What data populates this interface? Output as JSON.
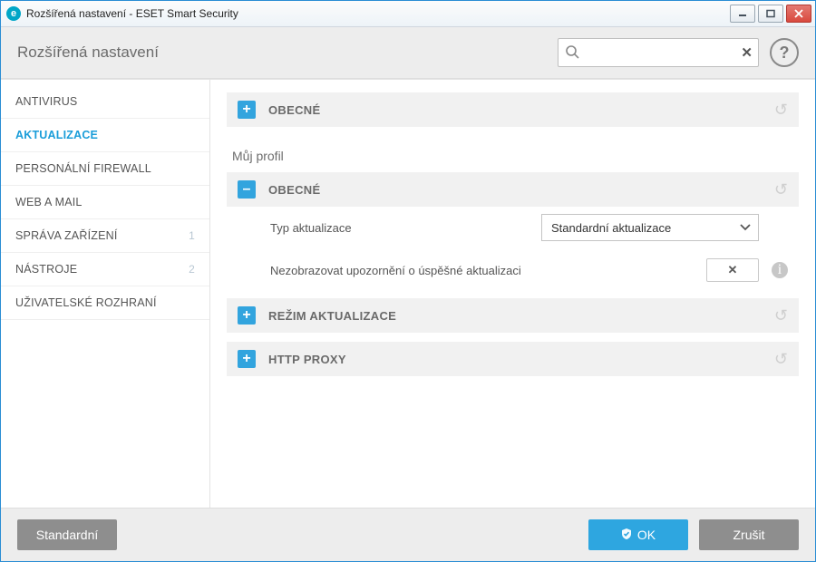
{
  "window": {
    "title": "Rozšířená nastavení - ESET Smart Security"
  },
  "header": {
    "title": "Rozšířená nastavení",
    "search_placeholder": ""
  },
  "sidebar": {
    "items": [
      {
        "label": "ANTIVIRUS",
        "badge": ""
      },
      {
        "label": "AKTUALIZACE",
        "badge": "",
        "active": true
      },
      {
        "label": "PERSONÁLNÍ FIREWALL",
        "badge": ""
      },
      {
        "label": "WEB A MAIL",
        "badge": ""
      },
      {
        "label": "SPRÁVA ZAŘÍZENÍ",
        "badge": "1"
      },
      {
        "label": "NÁSTROJE",
        "badge": "2"
      },
      {
        "label": "UŽIVATELSKÉ ROZHRANÍ",
        "badge": ""
      }
    ]
  },
  "main": {
    "sections": {
      "general_top": {
        "label": "OBECNÉ"
      },
      "profile_title": "Můj profil",
      "general_nested": {
        "label": "OBECNÉ"
      },
      "update_type": {
        "label": "Typ aktualizace",
        "value": "Standardní aktualizace"
      },
      "suppress_notice": {
        "label": "Nezobrazovat upozornění o úspěšné aktualizaci",
        "toggle_glyph": "✕"
      },
      "update_mode": {
        "label": "REŽIM AKTUALIZACE"
      },
      "http_proxy": {
        "label": "HTTP PROXY"
      }
    }
  },
  "footer": {
    "default_label": "Standardní",
    "ok_label": "OK",
    "cancel_label": "Zrušit"
  }
}
